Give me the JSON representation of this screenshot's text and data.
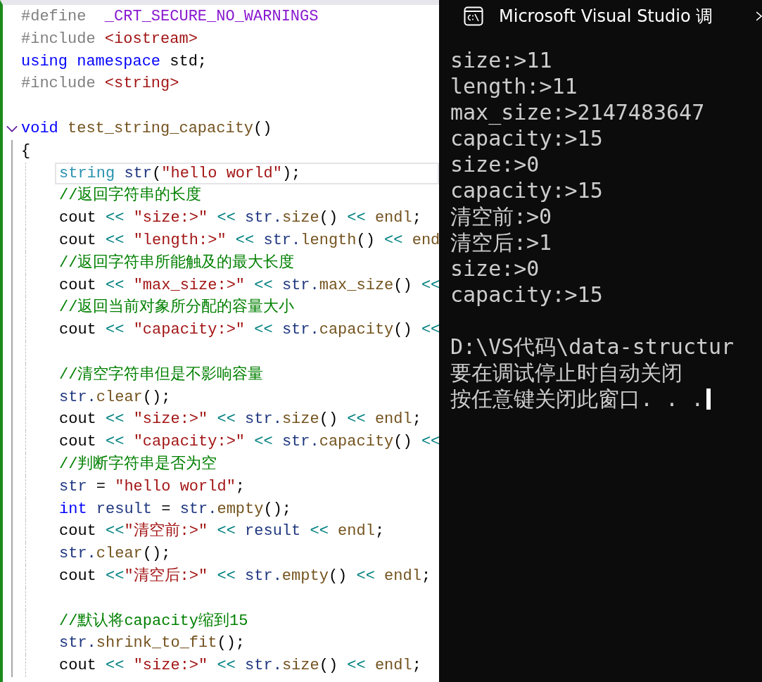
{
  "editor": {
    "lines": [
      {
        "current": false,
        "tokens": [
          {
            "kind": "preproc",
            "text": "#define  "
          },
          {
            "kind": "macro",
            "text": "_CRT_SECURE_NO_WARNINGS"
          }
        ]
      },
      {
        "current": false,
        "tokens": [
          {
            "kind": "preproc",
            "text": "#include "
          },
          {
            "kind": "header",
            "text": "<iostream>"
          }
        ]
      },
      {
        "current": false,
        "tokens": [
          {
            "kind": "keyword",
            "text": "using namespace "
          },
          {
            "kind": "plain",
            "text": "std;"
          }
        ]
      },
      {
        "current": false,
        "tokens": [
          {
            "kind": "preproc",
            "text": "#include "
          },
          {
            "kind": "header",
            "text": "<string>"
          }
        ]
      },
      {
        "current": false
      },
      {
        "current": false,
        "expanded": true,
        "tokens": [
          {
            "kind": "keyword",
            "text": "void "
          },
          {
            "kind": "function",
            "text": "test_string_capacity"
          },
          {
            "kind": "plain",
            "text": "()"
          }
        ]
      },
      {
        "current": false,
        "tokens": [
          {
            "kind": "plain",
            "text": "{"
          }
        ],
        "children": [
          {
            "current": true,
            "tokens": [
              {
                "kind": "type",
                "text": "string "
              },
              {
                "kind": "variable",
                "text": "str"
              },
              {
                "kind": "plain",
                "text": "("
              },
              {
                "kind": "string",
                "text": "\"hello world\""
              },
              {
                "kind": "plain",
                "text": ");"
              }
            ]
          },
          {
            "current": false,
            "tokens": [
              {
                "kind": "comment",
                "text": "//返回字符串的长度"
              }
            ]
          },
          {
            "current": false,
            "tokens": [
              {
                "kind": "plain",
                "text": "cout "
              },
              {
                "kind": "operator",
                "text": "<< "
              },
              {
                "kind": "string",
                "text": "\"size:>\" "
              },
              {
                "kind": "operator",
                "text": "<< "
              },
              {
                "kind": "variable",
                "text": "str."
              },
              {
                "kind": "function",
                "text": "size"
              },
              {
                "kind": "plain",
                "text": "() "
              },
              {
                "kind": "operator",
                "text": "<< "
              },
              {
                "kind": "function",
                "text": "endl"
              },
              {
                "kind": "plain",
                "text": ";"
              }
            ]
          },
          {
            "current": false,
            "tokens": [
              {
                "kind": "plain",
                "text": "cout "
              },
              {
                "kind": "operator",
                "text": "<< "
              },
              {
                "kind": "string",
                "text": "\"length:>\" "
              },
              {
                "kind": "operator",
                "text": "<< "
              },
              {
                "kind": "variable",
                "text": "str."
              },
              {
                "kind": "function",
                "text": "length"
              },
              {
                "kind": "plain",
                "text": "() "
              },
              {
                "kind": "operator",
                "text": "<< "
              },
              {
                "kind": "function",
                "text": "end"
              }
            ]
          },
          {
            "current": false,
            "tokens": [
              {
                "kind": "comment",
                "text": "//返回字符串所能触及的最大长度"
              }
            ]
          },
          {
            "current": false,
            "tokens": [
              {
                "kind": "plain",
                "text": "cout "
              },
              {
                "kind": "operator",
                "text": "<< "
              },
              {
                "kind": "string",
                "text": "\"max_size:>\" "
              },
              {
                "kind": "operator",
                "text": "<< "
              },
              {
                "kind": "variable",
                "text": "str."
              },
              {
                "kind": "function",
                "text": "max_size"
              },
              {
                "kind": "plain",
                "text": "() "
              },
              {
                "kind": "operator",
                "text": "<<"
              }
            ]
          },
          {
            "current": false,
            "tokens": [
              {
                "kind": "comment",
                "text": "//返回当前对象所分配的容量大小"
              }
            ]
          },
          {
            "current": false,
            "tokens": [
              {
                "kind": "plain",
                "text": "cout "
              },
              {
                "kind": "operator",
                "text": "<< "
              },
              {
                "kind": "string",
                "text": "\"capacity:>\" "
              },
              {
                "kind": "operator",
                "text": "<< "
              },
              {
                "kind": "variable",
                "text": "str."
              },
              {
                "kind": "function",
                "text": "capacity"
              },
              {
                "kind": "plain",
                "text": "() "
              },
              {
                "kind": "operator",
                "text": "<<"
              }
            ]
          },
          {
            "current": false
          },
          {
            "current": false,
            "tokens": [
              {
                "kind": "comment",
                "text": "//清空字符串但是不影响容量"
              }
            ]
          },
          {
            "current": false,
            "tokens": [
              {
                "kind": "variable",
                "text": "str."
              },
              {
                "kind": "function",
                "text": "clear"
              },
              {
                "kind": "plain",
                "text": "();"
              }
            ]
          },
          {
            "current": false,
            "tokens": [
              {
                "kind": "plain",
                "text": "cout "
              },
              {
                "kind": "operator",
                "text": "<< "
              },
              {
                "kind": "string",
                "text": "\"size:>\" "
              },
              {
                "kind": "operator",
                "text": "<< "
              },
              {
                "kind": "variable",
                "text": "str."
              },
              {
                "kind": "function",
                "text": "size"
              },
              {
                "kind": "plain",
                "text": "() "
              },
              {
                "kind": "operator",
                "text": "<< "
              },
              {
                "kind": "function",
                "text": "endl"
              },
              {
                "kind": "plain",
                "text": ";"
              }
            ]
          },
          {
            "current": false,
            "tokens": [
              {
                "kind": "plain",
                "text": "cout "
              },
              {
                "kind": "operator",
                "text": "<< "
              },
              {
                "kind": "string",
                "text": "\"capacity:>\" "
              },
              {
                "kind": "operator",
                "text": "<< "
              },
              {
                "kind": "variable",
                "text": "str."
              },
              {
                "kind": "function",
                "text": "capacity"
              },
              {
                "kind": "plain",
                "text": "() "
              },
              {
                "kind": "operator",
                "text": "<<"
              }
            ]
          },
          {
            "current": false,
            "tokens": [
              {
                "kind": "comment",
                "text": "//判断字符串是否为空"
              }
            ]
          },
          {
            "current": false,
            "tokens": [
              {
                "kind": "variable",
                "text": "str "
              },
              {
                "kind": "plain",
                "text": "= "
              },
              {
                "kind": "string",
                "text": "\"hello world\""
              },
              {
                "kind": "plain",
                "text": ";"
              }
            ]
          },
          {
            "current": false,
            "tokens": [
              {
                "kind": "keyword",
                "text": "int "
              },
              {
                "kind": "variable",
                "text": "result "
              },
              {
                "kind": "plain",
                "text": "= "
              },
              {
                "kind": "variable",
                "text": "str."
              },
              {
                "kind": "function",
                "text": "empty"
              },
              {
                "kind": "plain",
                "text": "();"
              }
            ]
          },
          {
            "current": false,
            "tokens": [
              {
                "kind": "plain",
                "text": "cout "
              },
              {
                "kind": "operator",
                "text": "<<"
              },
              {
                "kind": "string",
                "text": "\"清空前:>\" "
              },
              {
                "kind": "operator",
                "text": "<< "
              },
              {
                "kind": "variable",
                "text": "result "
              },
              {
                "kind": "operator",
                "text": "<< "
              },
              {
                "kind": "function",
                "text": "endl"
              },
              {
                "kind": "plain",
                "text": ";"
              }
            ]
          },
          {
            "current": false,
            "tokens": [
              {
                "kind": "variable",
                "text": "str."
              },
              {
                "kind": "function",
                "text": "clear"
              },
              {
                "kind": "plain",
                "text": "();"
              }
            ]
          },
          {
            "current": false,
            "tokens": [
              {
                "kind": "plain",
                "text": "cout "
              },
              {
                "kind": "operator",
                "text": "<<"
              },
              {
                "kind": "string",
                "text": "\"清空后:>\" "
              },
              {
                "kind": "operator",
                "text": "<< "
              },
              {
                "kind": "variable",
                "text": "str."
              },
              {
                "kind": "function",
                "text": "empty"
              },
              {
                "kind": "plain",
                "text": "() "
              },
              {
                "kind": "operator",
                "text": "<< "
              },
              {
                "kind": "function",
                "text": "endl"
              },
              {
                "kind": "plain",
                "text": ";"
              }
            ]
          },
          {
            "current": false
          },
          {
            "current": false,
            "tokens": [
              {
                "kind": "comment",
                "text": "//默认将capacity缩到15"
              }
            ]
          },
          {
            "current": false,
            "tokens": [
              {
                "kind": "variable",
                "text": "str."
              },
              {
                "kind": "function",
                "text": "shrink_to_fit"
              },
              {
                "kind": "plain",
                "text": "();"
              }
            ]
          },
          {
            "current": false,
            "tokens": [
              {
                "kind": "plain",
                "text": "cout "
              },
              {
                "kind": "operator",
                "text": "<< "
              },
              {
                "kind": "string",
                "text": "\"size:>\" "
              },
              {
                "kind": "operator",
                "text": "<< "
              },
              {
                "kind": "variable",
                "text": "str."
              },
              {
                "kind": "function",
                "text": "size"
              },
              {
                "kind": "plain",
                "text": "() "
              },
              {
                "kind": "operator",
                "text": "<< "
              },
              {
                "kind": "function",
                "text": "endl"
              },
              {
                "kind": "plain",
                "text": ";"
              }
            ]
          }
        ]
      }
    ]
  },
  "console": {
    "title": "Microsoft Visual Studio 调",
    "output": [
      "size:>11",
      "length:>11",
      "max_size:>2147483647",
      "capacity:>15",
      "size:>0",
      "capacity:>15",
      "清空前:>0",
      "清空后:>1",
      "size:>0",
      "capacity:>15"
    ],
    "messages": [
      "D:\\VS代码\\data-structur",
      "要在调试停止时自动关闭",
      "按任意键关闭此窗口. . ."
    ],
    "cursor": true
  }
}
